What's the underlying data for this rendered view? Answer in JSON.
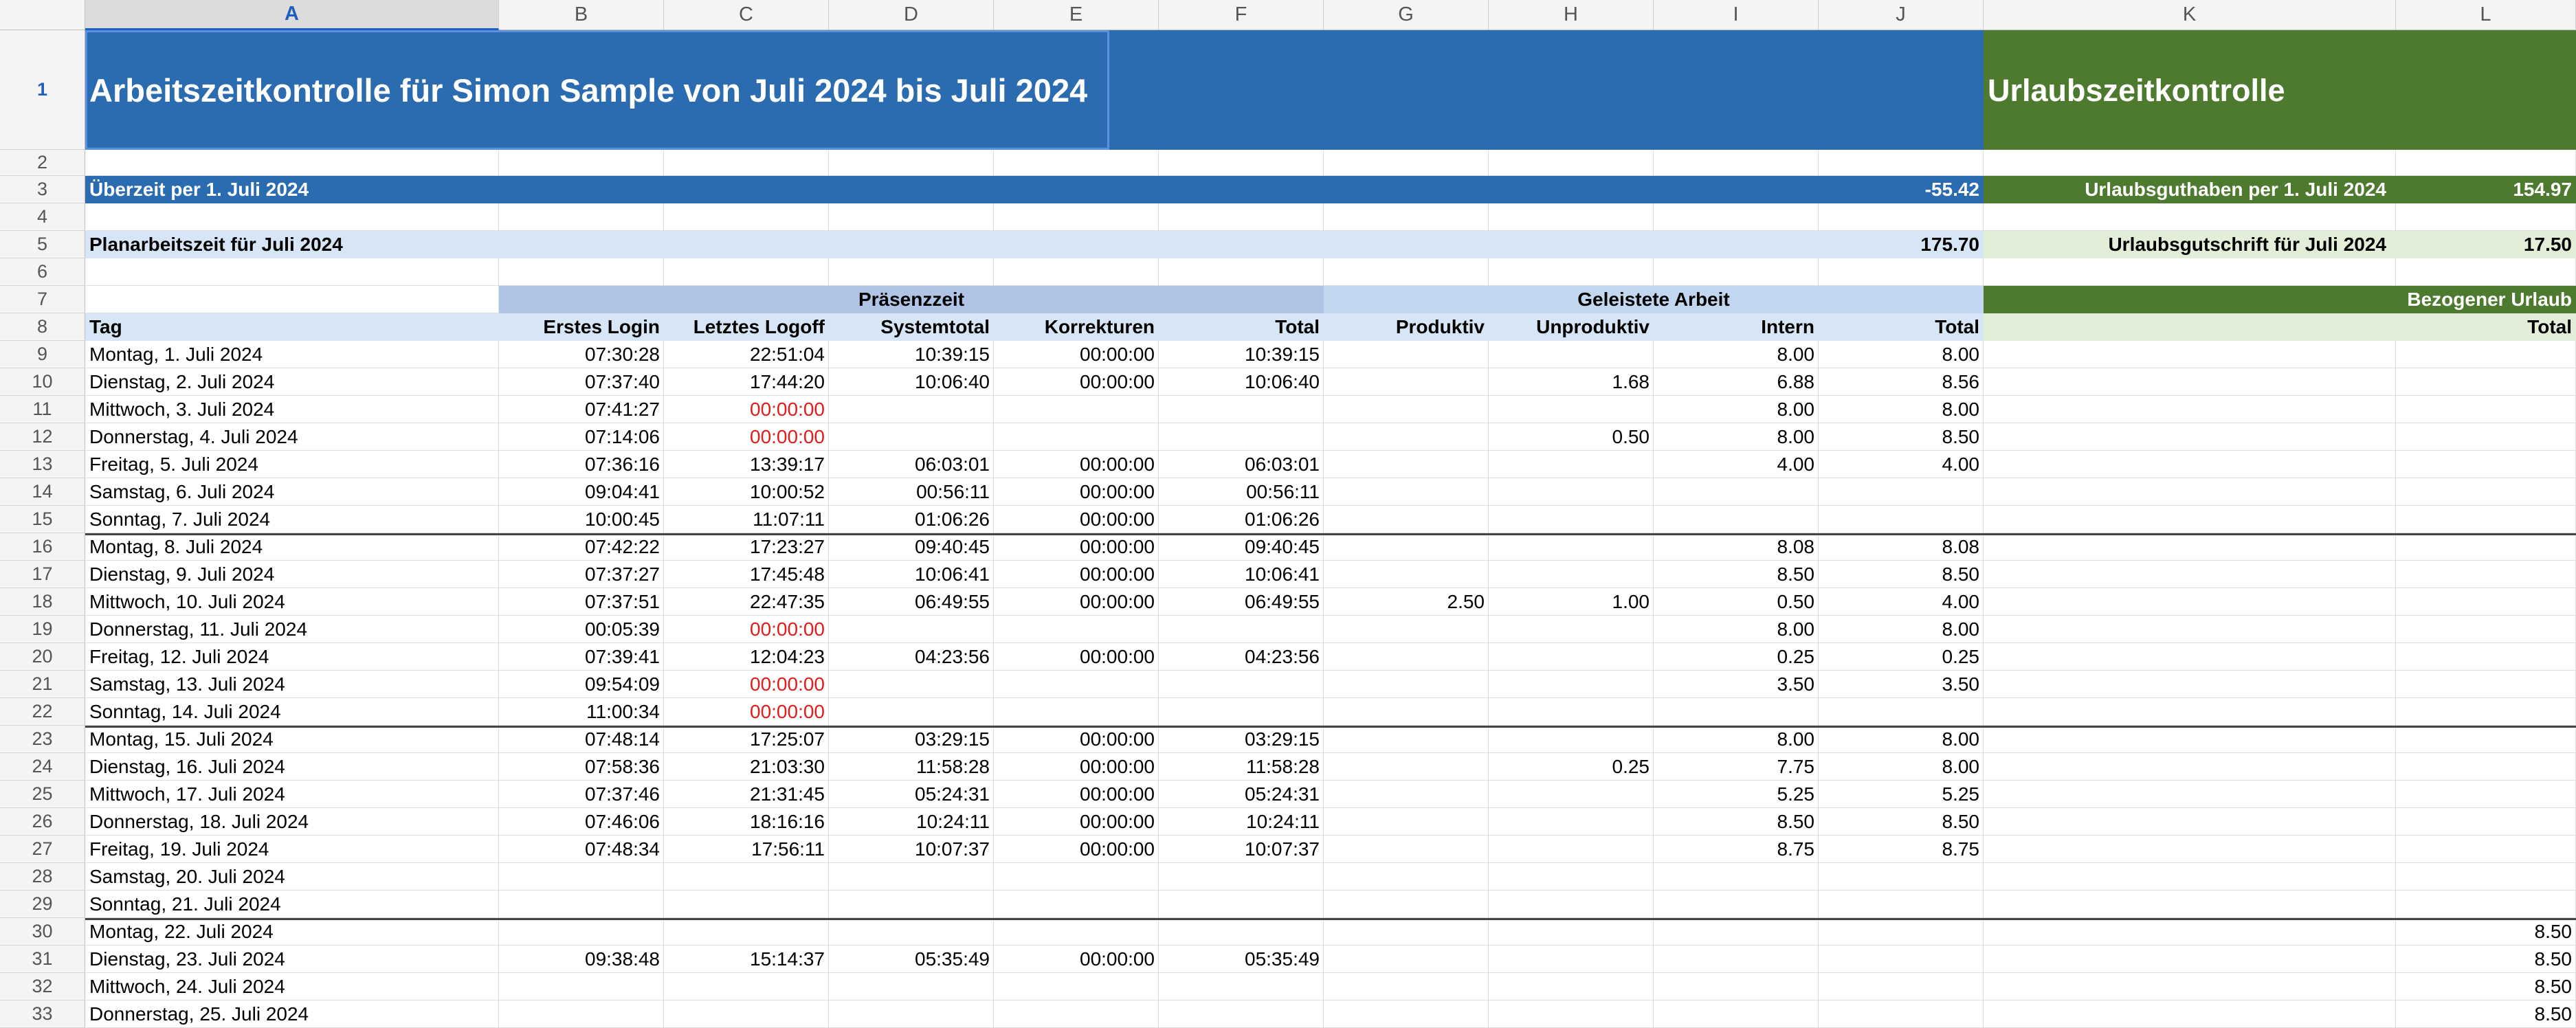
{
  "columns": [
    "A",
    "B",
    "C",
    "D",
    "E",
    "F",
    "G",
    "H",
    "I",
    "J",
    "K",
    "L"
  ],
  "selected_column": "A",
  "selected_row": 1,
  "colors": {
    "blue_header": "#2b6cb0",
    "light_blue": "#d7e6f6",
    "group_blue": "#b0c4e6",
    "group_blue2": "#c0d7ef",
    "green_header": "#4e7a30",
    "light_green": "#e3eed8",
    "red_text": "#e31b1b"
  },
  "title": {
    "main": "Arbeitszeitkontrolle für Simon Sample von Juli 2024 bis Juli 2024",
    "vacation": "Urlaubszeitkontrolle"
  },
  "summary": {
    "overtime_label": "Überzeit per 1. Juli 2024",
    "overtime_value": "-55.42",
    "vacation_balance_label": "Urlaubsguthaben per 1. Juli 2024",
    "vacation_balance_value": "154.97",
    "planned_label": "Planarbeitszeit für Juli 2024",
    "planned_value": "175.70",
    "vacation_credit_label": "Urlaubsgutschrift für Juli 2024",
    "vacation_credit_value": "17.50"
  },
  "groups": {
    "presence": "Präsenzzeit",
    "work": "Geleistete Arbeit",
    "vacation": "Bezogener Urlaub"
  },
  "headers": [
    "Tag",
    "Erstes Login",
    "Letztes Logoff",
    "Systemtotal",
    "Korrekturen",
    "Total",
    "Produktiv",
    "Unproduktiv",
    "Intern",
    "Total",
    "",
    "Total"
  ],
  "rows": [
    {
      "day": "Montag, 1. Juli 2024",
      "login": "07:30:28",
      "logoff": "22:51:04",
      "system": "10:39:15",
      "korr": "00:00:00",
      "total": "10:39:15",
      "prod": "",
      "unprod": "",
      "intern": "8.00",
      "wtotal": "8.00",
      "vac": "",
      "logoff_red": false
    },
    {
      "day": "Dienstag, 2. Juli 2024",
      "login": "07:37:40",
      "logoff": "17:44:20",
      "system": "10:06:40",
      "korr": "00:00:00",
      "total": "10:06:40",
      "prod": "",
      "unprod": "1.68",
      "intern": "6.88",
      "wtotal": "8.56",
      "vac": "",
      "logoff_red": false
    },
    {
      "day": "Mittwoch, 3. Juli 2024",
      "login": "07:41:27",
      "logoff": "00:00:00",
      "system": "",
      "korr": "",
      "total": "",
      "prod": "",
      "unprod": "",
      "intern": "8.00",
      "wtotal": "8.00",
      "vac": "",
      "logoff_red": true
    },
    {
      "day": "Donnerstag, 4. Juli 2024",
      "login": "07:14:06",
      "logoff": "00:00:00",
      "system": "",
      "korr": "",
      "total": "",
      "prod": "",
      "unprod": "0.50",
      "intern": "8.00",
      "wtotal": "8.50",
      "vac": "",
      "logoff_red": true
    },
    {
      "day": "Freitag, 5. Juli 2024",
      "login": "07:36:16",
      "logoff": "13:39:17",
      "system": "06:03:01",
      "korr": "00:00:00",
      "total": "06:03:01",
      "prod": "",
      "unprod": "",
      "intern": "4.00",
      "wtotal": "4.00",
      "vac": "",
      "logoff_red": false
    },
    {
      "day": "Samstag, 6. Juli 2024",
      "login": "09:04:41",
      "logoff": "10:00:52",
      "system": "00:56:11",
      "korr": "00:00:00",
      "total": "00:56:11",
      "prod": "",
      "unprod": "",
      "intern": "",
      "wtotal": "",
      "vac": "",
      "logoff_red": false
    },
    {
      "day": "Sonntag, 7. Juli 2024",
      "login": "10:00:45",
      "logoff": "11:07:11",
      "system": "01:06:26",
      "korr": "00:00:00",
      "total": "01:06:26",
      "prod": "",
      "unprod": "",
      "intern": "",
      "wtotal": "",
      "vac": "",
      "logoff_red": false
    },
    {
      "day": "Montag, 8. Juli 2024",
      "login": "07:42:22",
      "logoff": "17:23:27",
      "system": "09:40:45",
      "korr": "00:00:00",
      "total": "09:40:45",
      "prod": "",
      "unprod": "",
      "intern": "8.08",
      "wtotal": "8.08",
      "vac": "",
      "logoff_red": false,
      "week_start": true
    },
    {
      "day": "Dienstag, 9. Juli 2024",
      "login": "07:37:27",
      "logoff": "17:45:48",
      "system": "10:06:41",
      "korr": "00:00:00",
      "total": "10:06:41",
      "prod": "",
      "unprod": "",
      "intern": "8.50",
      "wtotal": "8.50",
      "vac": "",
      "logoff_red": false
    },
    {
      "day": "Mittwoch, 10. Juli 2024",
      "login": "07:37:51",
      "logoff": "22:47:35",
      "system": "06:49:55",
      "korr": "00:00:00",
      "total": "06:49:55",
      "prod": "2.50",
      "unprod": "1.00",
      "intern": "0.50",
      "wtotal": "4.00",
      "vac": "",
      "logoff_red": false
    },
    {
      "day": "Donnerstag, 11. Juli 2024",
      "login": "00:05:39",
      "logoff": "00:00:00",
      "system": "",
      "korr": "",
      "total": "",
      "prod": "",
      "unprod": "",
      "intern": "8.00",
      "wtotal": "8.00",
      "vac": "",
      "logoff_red": true
    },
    {
      "day": "Freitag, 12. Juli 2024",
      "login": "07:39:41",
      "logoff": "12:04:23",
      "system": "04:23:56",
      "korr": "00:00:00",
      "total": "04:23:56",
      "prod": "",
      "unprod": "",
      "intern": "0.25",
      "wtotal": "0.25",
      "vac": "",
      "logoff_red": false
    },
    {
      "day": "Samstag, 13. Juli 2024",
      "login": "09:54:09",
      "logoff": "00:00:00",
      "system": "",
      "korr": "",
      "total": "",
      "prod": "",
      "unprod": "",
      "intern": "3.50",
      "wtotal": "3.50",
      "vac": "",
      "logoff_red": true
    },
    {
      "day": "Sonntag, 14. Juli 2024",
      "login": "11:00:34",
      "logoff": "00:00:00",
      "system": "",
      "korr": "",
      "total": "",
      "prod": "",
      "unprod": "",
      "intern": "",
      "wtotal": "",
      "vac": "",
      "logoff_red": true
    },
    {
      "day": "Montag, 15. Juli 2024",
      "login": "07:48:14",
      "logoff": "17:25:07",
      "system": "03:29:15",
      "korr": "00:00:00",
      "total": "03:29:15",
      "prod": "",
      "unprod": "",
      "intern": "8.00",
      "wtotal": "8.00",
      "vac": "",
      "logoff_red": false,
      "week_start": true
    },
    {
      "day": "Dienstag, 16. Juli 2024",
      "login": "07:58:36",
      "logoff": "21:03:30",
      "system": "11:58:28",
      "korr": "00:00:00",
      "total": "11:58:28",
      "prod": "",
      "unprod": "0.25",
      "intern": "7.75",
      "wtotal": "8.00",
      "vac": "",
      "logoff_red": false
    },
    {
      "day": "Mittwoch, 17. Juli 2024",
      "login": "07:37:46",
      "logoff": "21:31:45",
      "system": "05:24:31",
      "korr": "00:00:00",
      "total": "05:24:31",
      "prod": "",
      "unprod": "",
      "intern": "5.25",
      "wtotal": "5.25",
      "vac": "",
      "logoff_red": false
    },
    {
      "day": "Donnerstag, 18. Juli 2024",
      "login": "07:46:06",
      "logoff": "18:16:16",
      "system": "10:24:11",
      "korr": "00:00:00",
      "total": "10:24:11",
      "prod": "",
      "unprod": "",
      "intern": "8.50",
      "wtotal": "8.50",
      "vac": "",
      "logoff_red": false
    },
    {
      "day": "Freitag, 19. Juli 2024",
      "login": "07:48:34",
      "logoff": "17:56:11",
      "system": "10:07:37",
      "korr": "00:00:00",
      "total": "10:07:37",
      "prod": "",
      "unprod": "",
      "intern": "8.75",
      "wtotal": "8.75",
      "vac": "",
      "logoff_red": false
    },
    {
      "day": "Samstag, 20. Juli 2024",
      "login": "",
      "logoff": "",
      "system": "",
      "korr": "",
      "total": "",
      "prod": "",
      "unprod": "",
      "intern": "",
      "wtotal": "",
      "vac": "",
      "logoff_red": false
    },
    {
      "day": "Sonntag, 21. Juli 2024",
      "login": "",
      "logoff": "",
      "system": "",
      "korr": "",
      "total": "",
      "prod": "",
      "unprod": "",
      "intern": "",
      "wtotal": "",
      "vac": "",
      "logoff_red": false
    },
    {
      "day": "Montag, 22. Juli 2024",
      "login": "",
      "logoff": "",
      "system": "",
      "korr": "",
      "total": "",
      "prod": "",
      "unprod": "",
      "intern": "",
      "wtotal": "",
      "vac": "8.50",
      "logoff_red": false,
      "week_start": true
    },
    {
      "day": "Dienstag, 23. Juli 2024",
      "login": "09:38:48",
      "logoff": "15:14:37",
      "system": "05:35:49",
      "korr": "00:00:00",
      "total": "05:35:49",
      "prod": "",
      "unprod": "",
      "intern": "",
      "wtotal": "",
      "vac": "8.50",
      "logoff_red": false
    },
    {
      "day": "Mittwoch, 24. Juli 2024",
      "login": "",
      "logoff": "",
      "system": "",
      "korr": "",
      "total": "",
      "prod": "",
      "unprod": "",
      "intern": "",
      "wtotal": "",
      "vac": "8.50",
      "logoff_red": false
    },
    {
      "day": "Donnerstag, 25. Juli 2024",
      "login": "",
      "logoff": "",
      "system": "",
      "korr": "",
      "total": "",
      "prod": "",
      "unprod": "",
      "intern": "",
      "wtotal": "",
      "vac": "8.50",
      "logoff_red": false
    }
  ]
}
